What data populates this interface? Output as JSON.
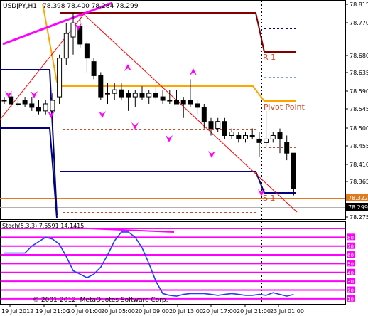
{
  "header": {
    "symbol_tf": "USDJPY,H1",
    "ohlc": "78.398 78.400 78.284 78.299"
  },
  "price_axis": {
    "ticks": [
      "78.815",
      "78.770",
      "78.680",
      "78.635",
      "78.590",
      "78.545",
      "78.500",
      "78.455",
      "78.410",
      "78.365",
      "78.275"
    ],
    "markers": [
      {
        "label": "78.322",
        "color": "#e07a1f"
      },
      {
        "label": "78.299",
        "color": "#000000"
      }
    ]
  },
  "pivot_labels": {
    "r1": "R 1",
    "pivot": "Pivot Point",
    "s1": "S 1"
  },
  "indicator": {
    "title": "Stoch(5,3,3) 7.5591 14.1415",
    "levels": [
      "80",
      "70",
      "60",
      "50",
      "40",
      "30",
      "20",
      "10"
    ]
  },
  "copyright": "© 2001-2012, MetaQuotes Software Corp.",
  "time_axis": [
    "19 Jul 2012",
    "19 Jul 21:00",
    "20 Jul 01:00",
    "20 Jul 05:00",
    "20 Jul 09:00",
    "20 Jul 13:00",
    "20 Jul 17:00",
    "20 Jul 21:00",
    "23 Jul 01:00"
  ],
  "colors": {
    "r1": "#800000",
    "pivot": "#ffa500",
    "s1": "#000080",
    "fractal": "#ff00ff",
    "stoch": "#1e3cff",
    "level": "#ff00ff",
    "trend": "#ff0000"
  },
  "chart_data": {
    "type": "candlestick",
    "price_range": [
      78.26,
      78.83
    ],
    "candles": [
      {
        "o": 78.55,
        "h": 78.56,
        "l": 78.54,
        "c": 78.55
      },
      {
        "o": 78.56,
        "h": 78.57,
        "l": 78.53,
        "c": 78.54
      },
      {
        "o": 78.54,
        "h": 78.55,
        "l": 78.53,
        "c": 78.54
      },
      {
        "o": 78.55,
        "h": 78.56,
        "l": 78.53,
        "c": 78.54
      },
      {
        "o": 78.54,
        "h": 78.56,
        "l": 78.52,
        "c": 78.53
      },
      {
        "o": 78.53,
        "h": 78.55,
        "l": 78.51,
        "c": 78.52
      },
      {
        "o": 78.52,
        "h": 78.55,
        "l": 78.51,
        "c": 78.54
      },
      {
        "o": 78.52,
        "h": 78.57,
        "l": 78.51,
        "c": 78.55
      },
      {
        "o": 78.56,
        "h": 78.68,
        "l": 78.54,
        "c": 78.67
      },
      {
        "o": 78.67,
        "h": 78.77,
        "l": 78.65,
        "c": 78.74
      },
      {
        "o": 78.73,
        "h": 78.8,
        "l": 78.68,
        "c": 78.77
      },
      {
        "o": 78.76,
        "h": 78.79,
        "l": 78.7,
        "c": 78.71
      },
      {
        "o": 78.71,
        "h": 78.72,
        "l": 78.63,
        "c": 78.67
      },
      {
        "o": 78.66,
        "h": 78.67,
        "l": 78.61,
        "c": 78.62
      },
      {
        "o": 78.62,
        "h": 78.63,
        "l": 78.55,
        "c": 78.56
      },
      {
        "o": 78.57,
        "h": 78.6,
        "l": 78.54,
        "c": 78.57
      },
      {
        "o": 78.57,
        "h": 78.6,
        "l": 78.55,
        "c": 78.58
      },
      {
        "o": 78.58,
        "h": 78.6,
        "l": 78.55,
        "c": 78.56
      },
      {
        "o": 78.57,
        "h": 78.58,
        "l": 78.52,
        "c": 78.56
      },
      {
        "o": 78.56,
        "h": 78.58,
        "l": 78.53,
        "c": 78.57
      },
      {
        "o": 78.57,
        "h": 78.59,
        "l": 78.55,
        "c": 78.56
      },
      {
        "o": 78.56,
        "h": 78.58,
        "l": 78.54,
        "c": 78.57
      },
      {
        "o": 78.57,
        "h": 78.59,
        "l": 78.55,
        "c": 78.56
      },
      {
        "o": 78.56,
        "h": 78.58,
        "l": 78.54,
        "c": 78.55
      },
      {
        "o": 78.55,
        "h": 78.58,
        "l": 78.54,
        "c": 78.55
      },
      {
        "o": 78.55,
        "h": 78.58,
        "l": 78.54,
        "c": 78.54
      },
      {
        "o": 78.55,
        "h": 78.56,
        "l": 78.5,
        "c": 78.54
      },
      {
        "o": 78.55,
        "h": 78.61,
        "l": 78.53,
        "c": 78.54
      },
      {
        "o": 78.54,
        "h": 78.55,
        "l": 78.51,
        "c": 78.53
      },
      {
        "o": 78.53,
        "h": 78.54,
        "l": 78.47,
        "c": 78.49
      },
      {
        "o": 78.49,
        "h": 78.5,
        "l": 78.45,
        "c": 78.47
      },
      {
        "o": 78.47,
        "h": 78.5,
        "l": 78.46,
        "c": 78.49
      },
      {
        "o": 78.49,
        "h": 78.5,
        "l": 78.44,
        "c": 78.45
      },
      {
        "o": 78.45,
        "h": 78.47,
        "l": 78.44,
        "c": 78.46
      },
      {
        "o": 78.45,
        "h": 78.46,
        "l": 78.43,
        "c": 78.44
      },
      {
        "o": 78.44,
        "h": 78.46,
        "l": 78.43,
        "c": 78.45
      },
      {
        "o": 78.45,
        "h": 78.47,
        "l": 78.44,
        "c": 78.45
      },
      {
        "o": 78.44,
        "h": 78.46,
        "l": 78.39,
        "c": 78.43
      },
      {
        "o": 78.43,
        "h": 78.52,
        "l": 78.42,
        "c": 78.44
      },
      {
        "o": 78.44,
        "h": 78.46,
        "l": 78.43,
        "c": 78.45
      },
      {
        "o": 78.46,
        "h": 78.47,
        "l": 78.4,
        "c": 78.44
      },
      {
        "o": 78.43,
        "h": 78.45,
        "l": 78.38,
        "c": 78.4
      },
      {
        "o": 78.4,
        "h": 78.4,
        "l": 78.28,
        "c": 78.3
      }
    ],
    "stochastic": [
      62,
      62,
      62,
      62,
      70,
      75,
      80,
      78,
      72,
      58,
      42,
      38,
      34,
      38,
      46,
      60,
      76,
      86,
      86,
      80,
      68,
      50,
      30,
      16,
      14,
      13,
      15,
      16,
      16,
      16,
      15,
      14,
      15,
      16,
      15,
      14,
      14,
      15,
      14,
      17,
      15,
      13,
      15
    ],
    "stoch_range": [
      0,
      100
    ]
  }
}
